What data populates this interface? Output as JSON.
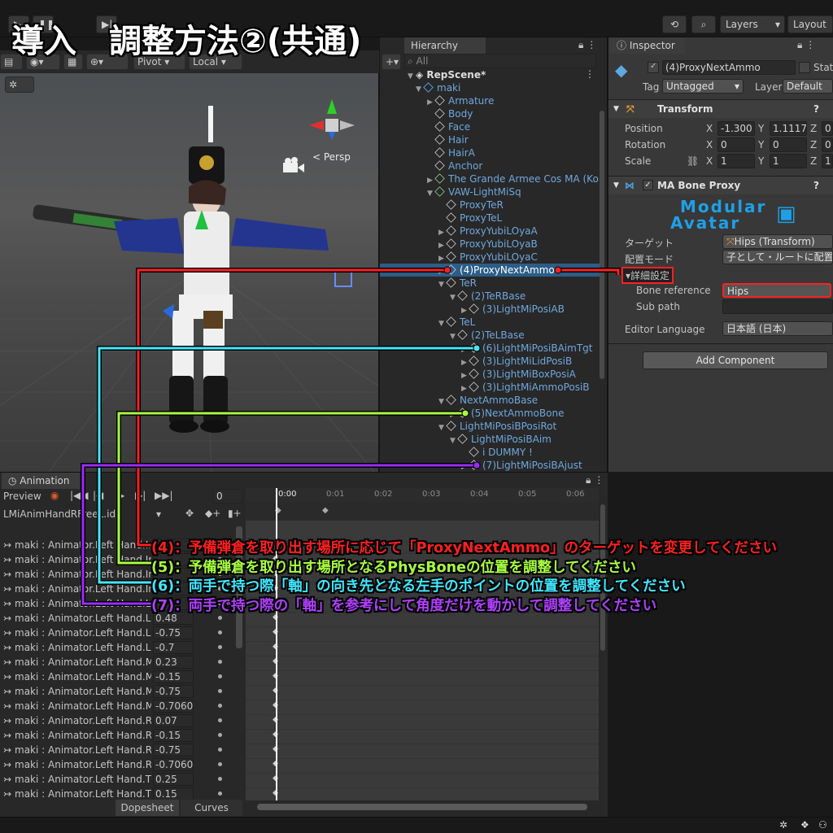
{
  "banner_title": "導入　調整方法②(共通)",
  "topbar": {
    "history_icon": "history-icon",
    "search_icon": "search-icon",
    "layers_label": "Layers",
    "layout_label": "Layout"
  },
  "scene_toolbar": {
    "pivot_label": "Pivot",
    "local_label": "Local",
    "persp_label": "< Persp"
  },
  "hierarchy": {
    "tab_label": "Hierarchy",
    "search_placeholder": "All",
    "scene_name": "RepScene*",
    "rows": [
      {
        "label": "maki",
        "depth": 1,
        "icon": "prefab",
        "expanded": true
      },
      {
        "label": "Armature",
        "depth": 2,
        "icon": "cube",
        "expanded": false
      },
      {
        "label": "Body",
        "depth": 2,
        "icon": "cube",
        "expanded": null
      },
      {
        "label": "Face",
        "depth": 2,
        "icon": "cube",
        "expanded": null
      },
      {
        "label": "Hair",
        "depth": 2,
        "icon": "cube",
        "expanded": null
      },
      {
        "label": "HairA",
        "depth": 2,
        "icon": "cube",
        "expanded": null
      },
      {
        "label": "Anchor",
        "depth": 2,
        "icon": "cube",
        "expanded": null
      },
      {
        "label": "The Grande Armee Cos MA (Ko",
        "depth": 2,
        "icon": "prefab-variant",
        "expanded": false
      },
      {
        "label": "VAW-LightMiSq",
        "depth": 2,
        "icon": "prefab-variant",
        "expanded": true
      },
      {
        "label": "ProxyTeR",
        "depth": 3,
        "icon": "cube",
        "expanded": null
      },
      {
        "label": "ProxyTeL",
        "depth": 3,
        "icon": "cube",
        "expanded": null
      },
      {
        "label": "ProxyYubiLOyaA",
        "depth": 3,
        "icon": "cube",
        "expanded": false
      },
      {
        "label": "ProxyYubiLOyaB",
        "depth": 3,
        "icon": "cube",
        "expanded": false
      },
      {
        "label": "ProxyYubiLOyaC",
        "depth": 3,
        "icon": "cube",
        "expanded": false
      },
      {
        "label": "(4)ProxyNextAmmo",
        "depth": 3,
        "icon": "cube",
        "expanded": false,
        "selected": true
      },
      {
        "label": "TeR",
        "depth": 3,
        "icon": "cube",
        "expanded": true
      },
      {
        "label": "(2)TeRBase",
        "depth": 4,
        "icon": "cube",
        "expanded": true
      },
      {
        "label": "(3)LightMiPosiAB",
        "depth": 5,
        "icon": "cube",
        "expanded": false
      },
      {
        "label": "TeL",
        "depth": 3,
        "icon": "cube",
        "expanded": true
      },
      {
        "label": "(2)TeLBase",
        "depth": 4,
        "icon": "cube",
        "expanded": true
      },
      {
        "label": "(6)LightMiPosiBAimTgt",
        "depth": 5,
        "icon": "cube",
        "expanded": false
      },
      {
        "label": "(3)LightMiLidPosiB",
        "depth": 5,
        "icon": "cube",
        "expanded": false
      },
      {
        "label": "(3)LightMiBoxPosiA",
        "depth": 5,
        "icon": "cube",
        "expanded": false
      },
      {
        "label": "(3)LightMiAmmoPosiB",
        "depth": 5,
        "icon": "cube",
        "expanded": false
      },
      {
        "label": "NextAmmoBase",
        "depth": 3,
        "icon": "cube",
        "expanded": true
      },
      {
        "label": "(5)NextAmmoBone",
        "depth": 4,
        "icon": "cube",
        "expanded": false
      },
      {
        "label": "LightMiPosiBPosiRot",
        "depth": 3,
        "icon": "cube",
        "expanded": true
      },
      {
        "label": "LightMiPosiBAim",
        "depth": 4,
        "icon": "cube",
        "expanded": true
      },
      {
        "label": "i DUMMY !",
        "depth": 5,
        "icon": "cube",
        "expanded": null
      },
      {
        "label": "(7)LightMiPosiBAjust",
        "depth": 5,
        "icon": "cube",
        "expanded": false
      }
    ]
  },
  "inspector": {
    "tab_label": "Inspector",
    "object_name": "(4)ProxyNextAmmo",
    "static_label": "Stat",
    "tag_label": "Tag",
    "tag_value": "Untagged",
    "layer_label": "Layer",
    "layer_value": "Default",
    "transform": {
      "title": "Transform",
      "position_label": "Position",
      "rotation_label": "Rotation",
      "scale_label": "Scale",
      "position": {
        "x": "-1.300",
        "y": "1.11176",
        "z": "0."
      },
      "rotation": {
        "x": "0",
        "y": "0",
        "z": "0"
      },
      "scale": {
        "x": "1",
        "y": "1",
        "z": "1"
      },
      "x": "X",
      "y": "Y",
      "z": "Z"
    },
    "bone_proxy": {
      "title": "MA Bone Proxy",
      "logo_line1": "Modular",
      "logo_line2": "Avatar",
      "target_label": "ターゲット",
      "target_value": "Hips (Transform)",
      "placement_label": "配置モード",
      "placement_value": "子として・ルートに配置",
      "advanced_label": "詳細設定",
      "bone_ref_label": "Bone reference",
      "bone_ref_value": "Hips",
      "sub_path_label": "Sub path",
      "sub_path_value": "",
      "editor_lang_label": "Editor Language",
      "editor_lang_value": "日本語 (日本)"
    },
    "add_component_label": "Add Component"
  },
  "animation": {
    "tab_label": "Animation",
    "preview_label": "Preview",
    "frame_value": "0",
    "clip_name": "LMiAnimHandRFreeL.id",
    "ticks": [
      "0:00",
      "0:01",
      "0:02",
      "0:03",
      "0:04",
      "0:05",
      "0:06"
    ],
    "rows": [
      {
        "name": "maki : Animator.Left Hand.In",
        "value": ""
      },
      {
        "name": "maki : Animator.Left Hand.In",
        "value": ""
      },
      {
        "name": "maki : Animator.Left Hand.In",
        "value": ""
      },
      {
        "name": "maki : Animator.Left Hand.In",
        "value": ""
      },
      {
        "name": "maki : Animator.Left Hand.L",
        "value": ""
      },
      {
        "name": "maki : Animator.Left Hand.L",
        "value": "0.48"
      },
      {
        "name": "maki : Animator.Left Hand.L",
        "value": "-0.75"
      },
      {
        "name": "maki : Animator.Left Hand.L",
        "value": "-0.7"
      },
      {
        "name": "maki : Animator.Left Hand.M",
        "value": "0.23"
      },
      {
        "name": "maki : Animator.Left Hand.M",
        "value": "-0.15"
      },
      {
        "name": "maki : Animator.Left Hand.M",
        "value": "-0.75"
      },
      {
        "name": "maki : Animator.Left Hand.M",
        "value": "-0.7060"
      },
      {
        "name": "maki : Animator.Left Hand.R",
        "value": "0.07"
      },
      {
        "name": "maki : Animator.Left Hand.R",
        "value": "-0.15"
      },
      {
        "name": "maki : Animator.Left Hand.R",
        "value": "-0.75"
      },
      {
        "name": "maki : Animator.Left Hand.R",
        "value": "-0.7060"
      },
      {
        "name": "maki : Animator.Left Hand.T",
        "value": "0.25"
      },
      {
        "name": "maki : Animator.Left Hand.T",
        "value": "0.15"
      }
    ],
    "dopesheet_label": "Dopesheet",
    "curves_label": "Curves"
  },
  "notes": [
    {
      "text": "(4)：予備弾倉を取り出す場所に応じて「ProxyNextAmmo」のターゲットを変更してください",
      "color": "#ff2020"
    },
    {
      "text": "(5)：予備弾倉を取り出す場所となるPhysBoneの位置を調整してください",
      "color": "#a8ff40"
    },
    {
      "text": "(6)：両手で持つ際「軸」の向き先となる左手のポイントの位置を調整してください",
      "color": "#40e8ff"
    },
    {
      "text": "(7)：両手で持つ際の「軸」を参考にして角度だけを動かして調整してください",
      "color": "#b040ff"
    }
  ],
  "colors": {
    "note4": "#ff2020",
    "note5": "#a8ff40",
    "note6": "#40e8ff",
    "note7": "#9a2cff",
    "selection": "#2c5d87",
    "tree_text": "#6fa7dd"
  }
}
